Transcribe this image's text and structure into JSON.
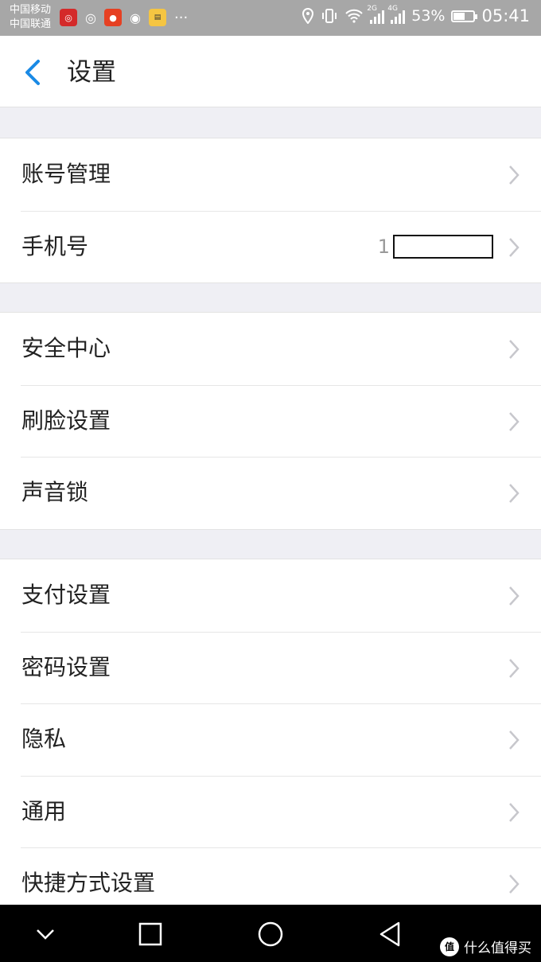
{
  "status_bar": {
    "carrier_1": "中国移动",
    "carrier_2": "中国联通",
    "signal_1_label": "2G",
    "signal_2_label": "4G",
    "battery": "53%",
    "battery_level": 0.53,
    "time": "05:41",
    "overflow": "···"
  },
  "header": {
    "title": "设置"
  },
  "groups": [
    {
      "items": [
        {
          "label": "账号管理"
        },
        {
          "label": "手机号",
          "value_prefix": "1"
        }
      ]
    },
    {
      "items": [
        {
          "label": "安全中心"
        },
        {
          "label": "刷脸设置"
        },
        {
          "label": "声音锁"
        }
      ]
    },
    {
      "items": [
        {
          "label": "支付设置"
        },
        {
          "label": "密码设置"
        },
        {
          "label": "隐私"
        },
        {
          "label": "通用"
        },
        {
          "label": "快捷方式设置"
        }
      ]
    }
  ],
  "watermark": {
    "logo": "值",
    "text": "什么值得买"
  },
  "colors": {
    "accent": "#1a8ae5",
    "background": "#efeff4",
    "status_bar": "#a7a7a7",
    "chevron": "#c7c7cc"
  }
}
